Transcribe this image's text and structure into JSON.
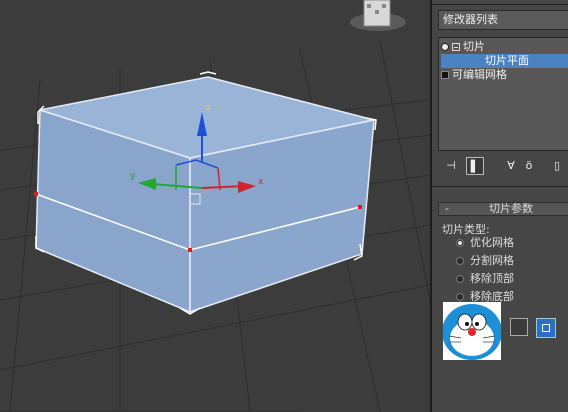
{
  "modifier_list": {
    "label": "修改器列表"
  },
  "stack": {
    "items": [
      {
        "label": "切片"
      },
      {
        "label": "切片平面"
      },
      {
        "label": "可编辑网格"
      }
    ]
  },
  "toolbar": {
    "icons": [
      "pin-stack-icon",
      "show-end-result-icon",
      "make-unique-icon",
      "remove-modifier-icon",
      "configure-icon"
    ]
  },
  "rollout": {
    "collapse": "-",
    "title": "切片参数",
    "slice_type_label": "切片类型:",
    "options": [
      {
        "label": "优化网格",
        "selected": true
      },
      {
        "label": "分割网格",
        "selected": false
      },
      {
        "label": "移除顶部",
        "selected": false
      },
      {
        "label": "移除底部",
        "selected": false
      }
    ]
  },
  "viewport": {
    "gizmo": {
      "x_label": "x",
      "y_label": "y",
      "z_label": "z"
    }
  },
  "colors": {
    "selection": "#4a82c2",
    "box_face": "#8fa9cf",
    "x_axis": "#d0242c",
    "y_axis": "#22a833",
    "z_axis": "#1e4fd8",
    "active_button": "#2d6fc4"
  }
}
